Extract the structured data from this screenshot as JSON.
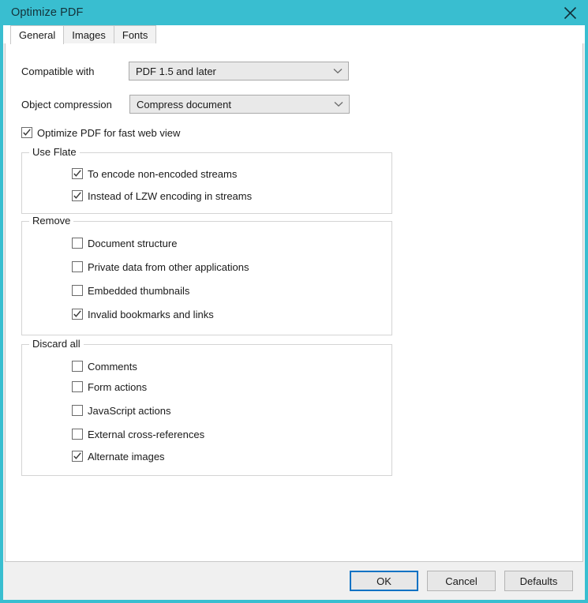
{
  "window": {
    "title": "Optimize PDF",
    "close_icon": "close-icon",
    "accent_color": "#39bed0",
    "focus_color": "#0a72c4"
  },
  "tabs": [
    {
      "label": "General",
      "active": true
    },
    {
      "label": "Images",
      "active": false
    },
    {
      "label": "Fonts",
      "active": false
    }
  ],
  "general": {
    "compatible_with": {
      "label": "Compatible with",
      "value": "PDF 1.5 and later",
      "chevron_icon": "chevron-down-icon"
    },
    "object_compression": {
      "label": "Object compression",
      "value": "Compress document",
      "chevron_icon": "chevron-down-icon"
    },
    "fast_web_view": {
      "label": "Optimize PDF for fast web view",
      "checked": true
    },
    "use_flate": {
      "title": "Use Flate",
      "items": [
        {
          "label": "To encode non-encoded streams",
          "checked": true
        },
        {
          "label": "Instead of LZW encoding in streams",
          "checked": true
        }
      ]
    },
    "remove": {
      "title": "Remove",
      "items": [
        {
          "label": "Document structure",
          "checked": false
        },
        {
          "label": "Private data from other applications",
          "checked": false
        },
        {
          "label": "Embedded thumbnails",
          "checked": false
        },
        {
          "label": "Invalid bookmarks and links",
          "checked": true
        }
      ]
    },
    "discard_all": {
      "title": "Discard all",
      "items": [
        {
          "label": "Comments",
          "checked": false
        },
        {
          "label": "Form actions",
          "checked": false
        },
        {
          "label": "JavaScript actions",
          "checked": false
        },
        {
          "label": "External cross-references",
          "checked": false
        },
        {
          "label": "Alternate images",
          "checked": true
        }
      ]
    }
  },
  "footer": {
    "ok": "OK",
    "cancel": "Cancel",
    "defaults": "Defaults"
  }
}
